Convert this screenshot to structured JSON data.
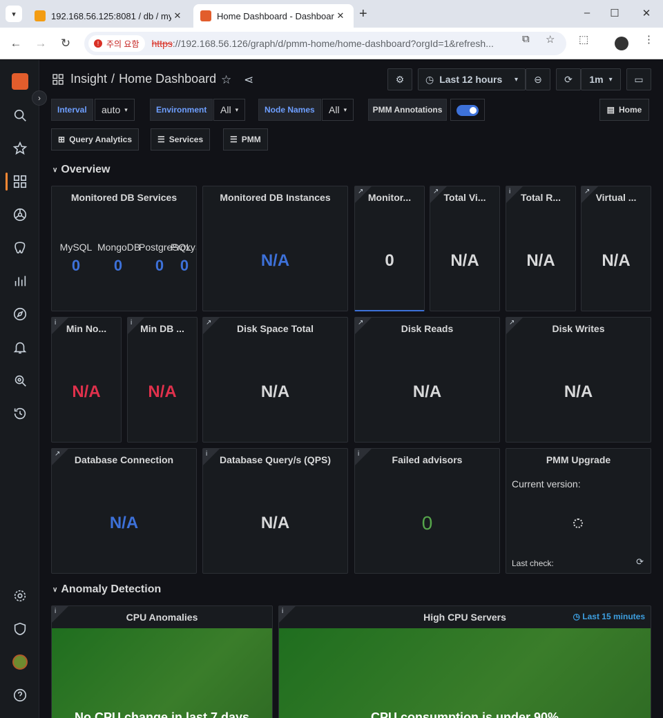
{
  "browser": {
    "tabs": [
      {
        "label": "192.168.56.125:8081 / db / my",
        "active": false
      },
      {
        "label": "Home Dashboard - Dashboard",
        "active": true
      }
    ],
    "security_warning": "주의 요함",
    "url_scheme": "https",
    "url_rest": "://192.168.56.126/graph/d/pmm-home/home-dashboard?orgId=1&refresh..."
  },
  "header": {
    "section": "Insight",
    "separator": "/",
    "title": "Home Dashboard",
    "time_range": "Last 12 hours",
    "refresh_interval": "1m"
  },
  "variables": [
    {
      "label": "Interval",
      "value": "auto"
    },
    {
      "label": "Environment",
      "value": "All"
    },
    {
      "label": "Node Names",
      "value": "All"
    }
  ],
  "annotations": {
    "label": "PMM Annotations",
    "enabled": true
  },
  "links": {
    "home": "Home",
    "query_analytics": "Query Analytics",
    "services": "Services",
    "pmm": "PMM"
  },
  "rows": {
    "overview": "Overview",
    "anomaly": "Anomaly Detection"
  },
  "panels": {
    "monitored_db_services": {
      "title": "Monitored DB Services",
      "stats": [
        {
          "label": "MySQL",
          "value": "0"
        },
        {
          "label": "MongoDB",
          "value": "0"
        },
        {
          "label": "PostgreSQL",
          "value": "0"
        },
        {
          "label": "ProxySQL",
          "value": "0"
        }
      ]
    },
    "monitored_db_instances": {
      "title": "Monitored DB Instances",
      "value": "N/A"
    },
    "monitored_nodes": {
      "title": "Monitor...",
      "value": "0"
    },
    "total_virtual": {
      "title": "Total Vi...",
      "value": "N/A"
    },
    "total_ram": {
      "title": "Total R...",
      "value": "N/A"
    },
    "virtual": {
      "title": "Virtual ...",
      "value": "N/A"
    },
    "min_node": {
      "title": "Min No...",
      "value": "N/A"
    },
    "min_db": {
      "title": "Min DB ...",
      "value": "N/A"
    },
    "disk_space_total": {
      "title": "Disk Space Total",
      "value": "N/A"
    },
    "disk_reads": {
      "title": "Disk Reads",
      "value": "N/A"
    },
    "disk_writes": {
      "title": "Disk Writes",
      "value": "N/A"
    },
    "database_connection": {
      "title": "Database Connection",
      "value": "N/A"
    },
    "database_qps": {
      "title": "Database Query/s (QPS)",
      "value": "N/A"
    },
    "failed_advisors": {
      "title": "Failed advisors",
      "value": "0"
    },
    "pmm_upgrade": {
      "title": "PMM Upgrade",
      "current_version_label": "Current version:",
      "last_check_label": "Last check:"
    },
    "cpu_anomalies": {
      "title": "CPU Anomalies",
      "message": "No CPU change in last 7 days"
    },
    "high_cpu_servers": {
      "title": "High CPU Servers",
      "time_badge": "Last 15 minutes",
      "message": "CPU consumption is under 90%"
    }
  },
  "colors": {
    "accent_blue": "#3d71d9",
    "value_red": "#e0314c",
    "value_green": "#56a64b",
    "panel_bg": "#181b1f",
    "page_bg": "#111217"
  }
}
